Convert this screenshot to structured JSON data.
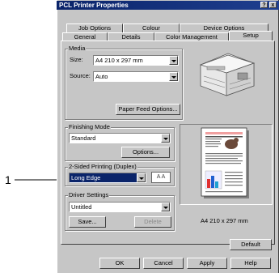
{
  "window": {
    "title": "PCL Printer Properties",
    "help_btn": "?",
    "close_btn": "x"
  },
  "tabs_row1": [
    "Job Options",
    "Colour",
    "Device Options"
  ],
  "tabs_row2": [
    "General",
    "Details",
    "Color Management",
    "Setup"
  ],
  "media": {
    "group_label": "Media",
    "size_label": "Size:",
    "size_value": "A4 210 x 297 mm",
    "source_label": "Source:",
    "source_value": "Auto",
    "paper_feed_button": "Paper Feed Options..."
  },
  "finishing": {
    "group_label": "Finishing Mode",
    "value": "Standard",
    "options_button": "Options..."
  },
  "duplex": {
    "group_label": "2-Sided Printing (Duplex)",
    "value": "Long Edge",
    "icon_letters": "A A"
  },
  "driver": {
    "group_label": "Driver Settings",
    "value": "Untitled",
    "save_button": "Save...",
    "delete_button": "Delete"
  },
  "preview": {
    "paper_size_text": "A4 210 x 297 mm"
  },
  "default_button": "Default",
  "bottom_buttons": [
    "OK",
    "Cancel",
    "Apply",
    "Help"
  ],
  "callout": {
    "number": "1"
  }
}
